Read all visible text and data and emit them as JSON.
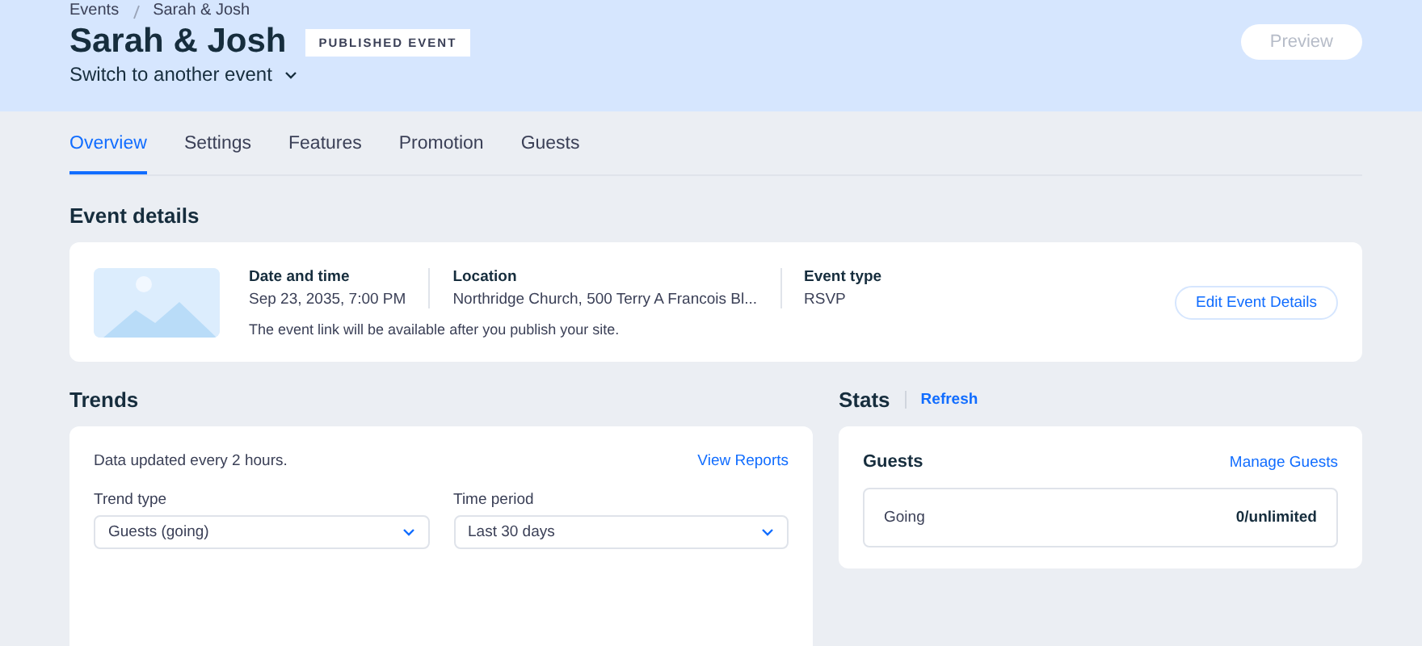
{
  "breadcrumb": [
    "Events",
    "Sarah & Josh"
  ],
  "header": {
    "title": "Sarah & Josh",
    "badge": "PUBLISHED EVENT",
    "switcher": "Switch to another event",
    "preview": {
      "label": "Preview",
      "disabled": true
    }
  },
  "tabs": [
    {
      "label": "Overview",
      "selected": true
    },
    {
      "label": "Settings",
      "selected": false
    },
    {
      "label": "Features",
      "selected": false
    },
    {
      "label": "Promotion",
      "selected": false
    },
    {
      "label": "Guests",
      "selected": false
    }
  ],
  "event_details": {
    "title": "Event details",
    "fields": [
      {
        "label": "Date and time",
        "value": "Sep 23, 2035, 7:00 PM"
      },
      {
        "label": "Location",
        "value": "Northridge Church, 500 Terry A Francois Bl..."
      },
      {
        "label": "Event type",
        "value": "RSVP"
      }
    ],
    "note": "The event link will be available after you publish your site.",
    "button": "Edit Event Details"
  },
  "trends": {
    "title": "Trends",
    "note": "Data updated every 2 hours.",
    "link": "View Reports",
    "selects": [
      {
        "label": "Trend type",
        "value": "Guests (going)"
      },
      {
        "label": "Time period",
        "value": "Last 30 days"
      }
    ]
  },
  "stats": {
    "title": "Stats",
    "refresh": "Refresh",
    "card_title": "Guests",
    "link": "Manage Guests",
    "rows": [
      {
        "label": "Going",
        "value": "0/unlimited"
      }
    ]
  }
}
